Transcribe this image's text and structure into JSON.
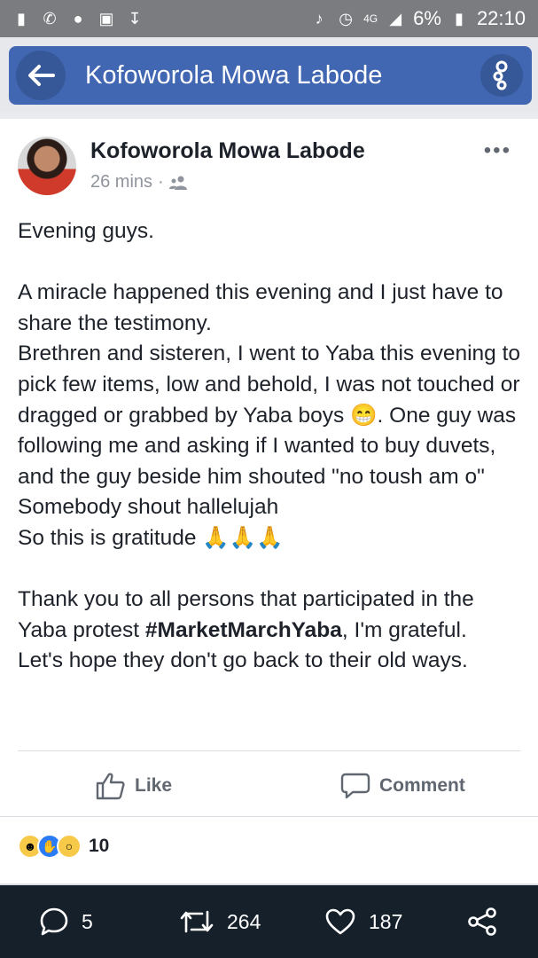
{
  "status_bar": {
    "battery": "6%",
    "time": "22:10",
    "network": "4G"
  },
  "app_bar": {
    "title": "Kofoworola Mowa Labode"
  },
  "post": {
    "author": "Kofoworola Mowa Labode",
    "time": "26 mins",
    "separator": "·",
    "lines": [
      "Evening guys.",
      "",
      "A miracle happened this evening and I just have to share the testimony.",
      "Brethren and sisteren, I went to Yaba this evening to pick few items, low and behold, I was not touched or dragged or grabbed by Yaba boys 😁. One guy was following me and asking if I wanted to buy duvets, and the guy beside him shouted \"no toush am o\"",
      "Somebody shout hallelujah",
      "So this is gratitude 🙏🙏🙏",
      "",
      "Thank you to all persons that participated in the Yaba protest "
    ],
    "hashtag": "#MarketMarchYaba",
    "after_hashtag": ",  I'm grateful.",
    "last_line": "Let's hope they don't go back to their old ways."
  },
  "actions": {
    "like_label": "Like",
    "comment_label": "Comment"
  },
  "reactions": {
    "count": "10"
  },
  "bottom_bar": {
    "replies": "5",
    "retweets": "264",
    "likes": "187"
  },
  "colors": {
    "fb_blue": "#4267b2",
    "dark_bar": "#15202b"
  }
}
